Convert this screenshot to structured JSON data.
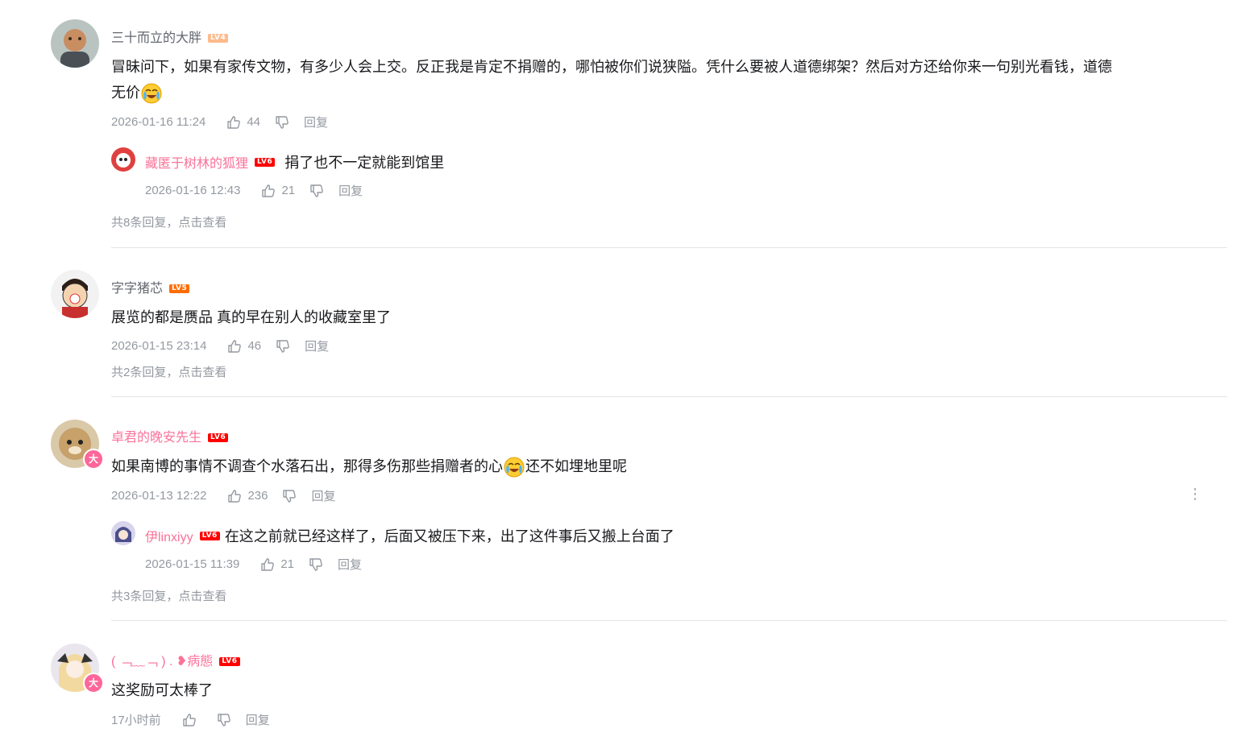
{
  "comments": [
    {
      "user": "三十而立的大胖",
      "level": "LV4",
      "text_a": "冒昧问下，如果有家传文物，有多少人会上交。反正我是肯定不捐赠的，哪怕被你们说狭隘。凭什么要被人道德绑架？然后对方还给你来一句别光看钱，道德",
      "text_b": "无价",
      "time": "2026-01-16 11:24",
      "likes": "44",
      "reply_label": "回复",
      "sub_reply": {
        "user": "藏匿于树林的狐狸",
        "level": "LV6",
        "text": "捐了也不一定就能到馆里",
        "time": "2026-01-16 12:43",
        "likes": "21",
        "reply_label": "回复"
      },
      "more_replies": "共8条回复，点击查看"
    },
    {
      "user": "字字猪芯",
      "level": "LV5",
      "text": "展览的都是赝品 真的早在别人的收藏室里了",
      "time": "2026-01-15 23:14",
      "likes": "46",
      "reply_label": "回复",
      "more_replies": "共2条回复，点击查看"
    },
    {
      "user": "卓君的晚安先生",
      "level": "LV6",
      "badge": "大",
      "text_a": "如果南博的事情不调查个水落石出，那得多伤那些捐赠者的心",
      "text_b": "还不如埋地里呢",
      "time": "2026-01-13 12:22",
      "likes": "236",
      "reply_label": "回复",
      "more_icon": "⋮",
      "sub_reply": {
        "user": "伊linxiyy",
        "level": "LV6",
        "text": "在这之前就已经这样了，后面又被压下来，出了这件事后又搬上台面了",
        "time": "2026-01-15 11:39",
        "likes": "21",
        "reply_label": "回复"
      },
      "more_replies": "共3条回复，点击查看"
    },
    {
      "user": "( ﹁﹏﹁ ) . ❥病態",
      "level": "LV6",
      "badge": "大",
      "text": "这奖励可太棒了",
      "time": "17小时前",
      "likes": "",
      "reply_label": "回复"
    }
  ],
  "colors": {
    "vip_name": "#fb7299",
    "meta": "#9499a0",
    "divider": "#e3e5e7"
  },
  "icons": [
    "thumbs-up-icon",
    "thumbs-down-icon",
    "more-vertical-icon",
    "crying-laugh-emoji"
  ]
}
